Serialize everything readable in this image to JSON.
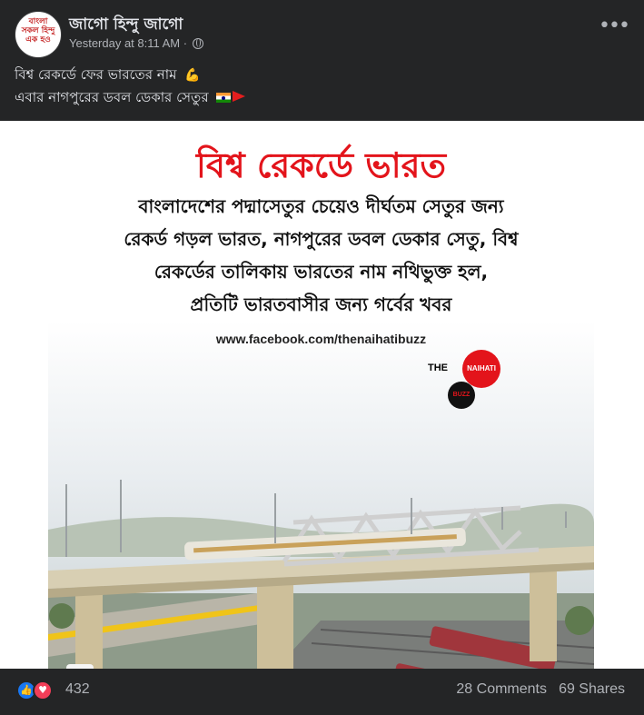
{
  "post": {
    "page_name": "জাগো হিন্দু জাগো",
    "timestamp": "Yesterday at 8:11 AM",
    "separator": " · ",
    "privacy_icon": "globe-icon",
    "more_label": "•••",
    "text_line1": "বিশ্ব রেকর্ডে ফের ভারতের নাম",
    "text_line2": "এবার নাগপুরের ডবল ডেকার সেতুর",
    "emoji_line1": "💪",
    "avatar_text": "বাংলা সকল হিন্দু এক হও"
  },
  "image": {
    "headline": "বিশ্ব রেকর্ডে ভারত",
    "body_lines": [
      "বাংলাদেশের পদ্মাসেতুর চেয়েও দীর্ঘতম সেতুর জন্য",
      "রেকর্ড গড়ল ভারত, নাগপুরের ডবল ডেকার সেতু, বিশ্ব",
      "রেকর্ডের তালিকায় ভারতের নাম নথিভুক্ত হল,",
      "প্রতিটি ভারতবাসীর জন্য গর্বের খবর"
    ],
    "url": "www.facebook.com/thenaihatibuzz",
    "logo_the": "THE",
    "logo_naihati": "NAIHATI",
    "logo_buzz": "BUZZ"
  },
  "footer": {
    "reaction_count": "432",
    "comments": "28 Comments",
    "shares": "69 Shares",
    "like_glyph": "👍",
    "love_glyph": "♥"
  },
  "colors": {
    "background": "#242526",
    "headline_red": "#e3141b",
    "like_blue": "#1877f2",
    "love_red": "#f33e58"
  }
}
